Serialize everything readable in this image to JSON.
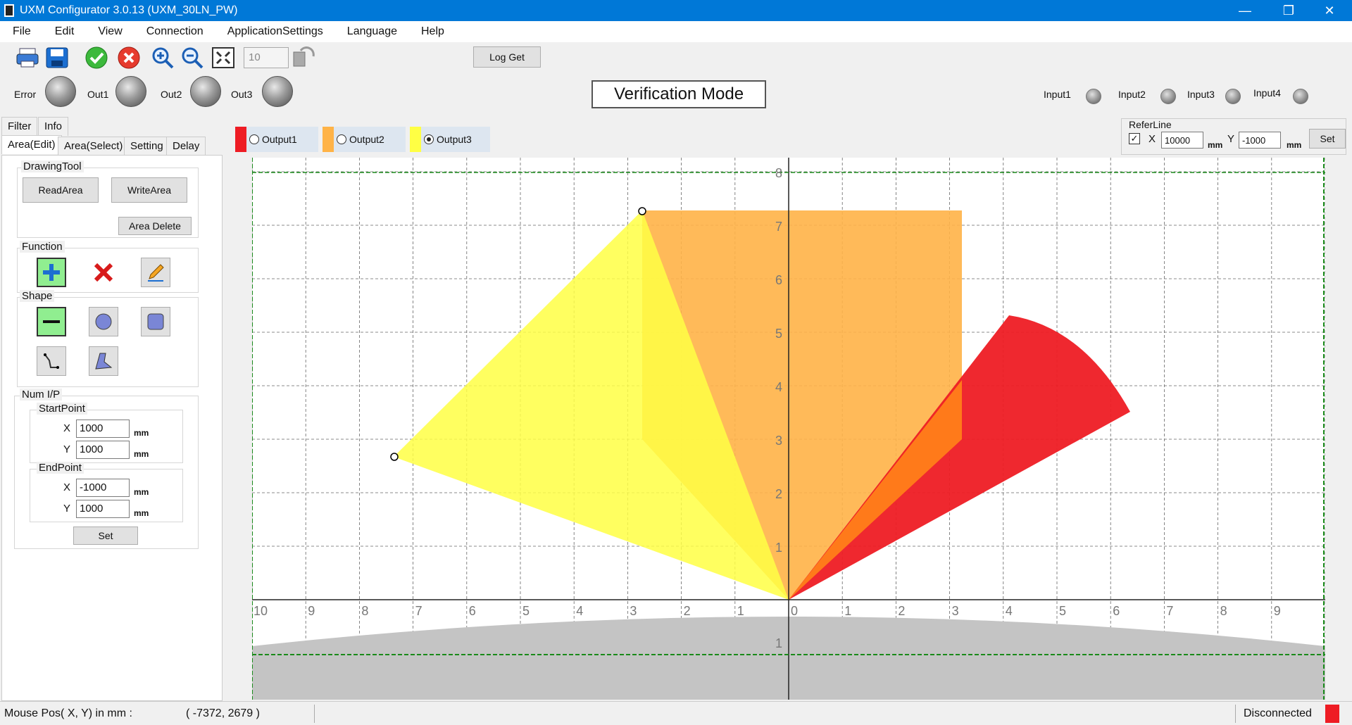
{
  "window": {
    "title": "UXM Configurator  3.0.13 (UXM_30LN_PW)",
    "controls": [
      "—",
      "❐",
      "✕"
    ]
  },
  "menu": [
    "File",
    "Edit",
    "View",
    "Connection",
    "ApplicationSettings",
    "Language",
    "Help"
  ],
  "toolbar": {
    "zoom_value": "10",
    "log_get_label": "Log Get",
    "icons": [
      "print-icon",
      "save-icon",
      "apply-icon",
      "cancel-icon",
      "zoom-in-icon",
      "zoom-out-icon",
      "fit-icon",
      "refresh-icon"
    ]
  },
  "status_lamps": {
    "error": "Error",
    "out1": "Out1",
    "out2": "Out2",
    "out3": "Out3",
    "inputs": [
      "Input1",
      "Input2",
      "Input3",
      "Input4"
    ]
  },
  "mode_label": "Verification Mode",
  "left_panel": {
    "tabs_top": [
      "Filter",
      "Info"
    ],
    "tabs": [
      "Area(Edit)",
      "Area(Select)",
      "Setting",
      "Delay"
    ],
    "drawing_tool": {
      "title": "DrawingTool",
      "read_area": "ReadArea",
      "write_area": "WriteArea",
      "area_delete": "Area Delete"
    },
    "function_title": "Function",
    "shape_title": "Shape",
    "num_ip": {
      "title": "Num I/P",
      "start_title": "StartPoint",
      "start_x": "1000",
      "start_y": "1000",
      "end_title": "EndPoint",
      "end_x": "-1000",
      "end_y": "1000",
      "x_label": "X",
      "y_label": "Y",
      "unit": "mm",
      "set_label": "Set"
    }
  },
  "outputs": [
    {
      "label": "Output1",
      "color": "#ee1c24",
      "selected": false
    },
    {
      "label": "Output2",
      "color": "#ffb347",
      "selected": false
    },
    {
      "label": "Output3",
      "color": "#ffff44",
      "selected": true
    }
  ],
  "refer_line": {
    "title": "ReferLine",
    "checked": true,
    "x_label": "X",
    "x_value": "10000",
    "y_label": "Y",
    "y_value": "-1000",
    "unit": "mm",
    "set_label": "Set"
  },
  "plot": {
    "x_ticks": [
      "10",
      "9",
      "8",
      "7",
      "6",
      "5",
      "4",
      "3",
      "2",
      "1",
      "0",
      "1",
      "2",
      "3",
      "4",
      "5",
      "6",
      "7",
      "8",
      "9",
      "10"
    ],
    "y_ticks": [
      "1",
      "2",
      "3",
      "4",
      "5",
      "6",
      "7",
      "8"
    ],
    "y_neg_tick": "1"
  },
  "statusbar": {
    "mouse_label": "Mouse Pos( X, Y) in mm :",
    "mouse_value": "( -7372, 2679 )",
    "connection": "Disconnected",
    "connection_color": "#ee1c24"
  }
}
